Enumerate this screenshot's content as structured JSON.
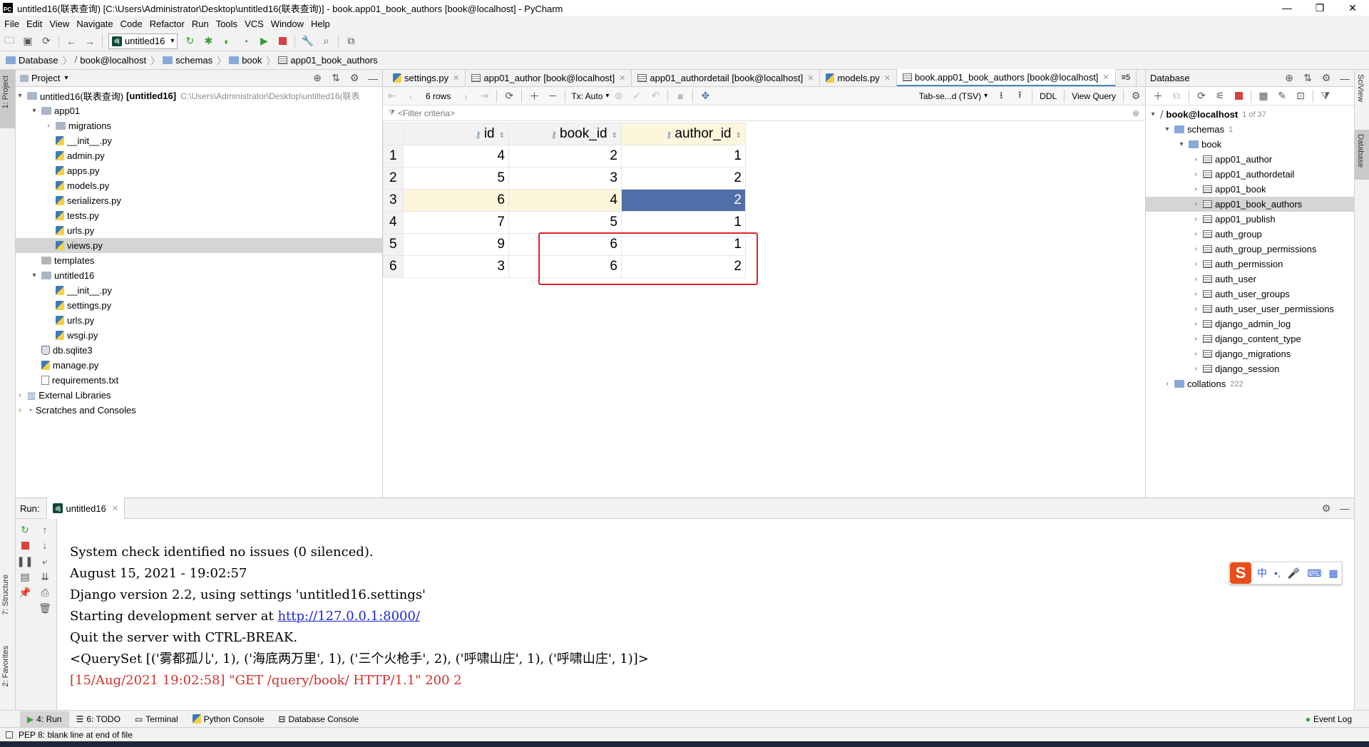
{
  "window": {
    "title": "untitled16(联表查询) [C:\\Users\\Administrator\\Desktop\\untitled16(联表查询)] - book.app01_book_authors [book@localhost] - PyCharm",
    "controls": [
      "—",
      "❐",
      "✕"
    ]
  },
  "menu": [
    "File",
    "Edit",
    "View",
    "Navigate",
    "Code",
    "Refactor",
    "Run",
    "Tools",
    "VCS",
    "Window",
    "Help"
  ],
  "toolbar": {
    "run_config": "untitled16"
  },
  "breadcrumb": [
    "Database",
    "book@localhost",
    "schemas",
    "book",
    "app01_book_authors"
  ],
  "left_strip": {
    "project_tab": "1: Project",
    "structure_tab": "7: Structure",
    "favorites_tab": "2: Favorites"
  },
  "project": {
    "header": "Project",
    "root_name": "untitled16(联表查询)",
    "root_module": "[untitled16]",
    "root_path": "C:\\Users\\Administrator\\Desktop\\untitled16(联表",
    "items": [
      {
        "label": "app01",
        "depth": 1,
        "type": "folder",
        "open": true
      },
      {
        "label": "migrations",
        "depth": 2,
        "type": "folder",
        "open": false
      },
      {
        "label": "__init__.py",
        "depth": 2,
        "type": "py"
      },
      {
        "label": "admin.py",
        "depth": 2,
        "type": "py"
      },
      {
        "label": "apps.py",
        "depth": 2,
        "type": "py"
      },
      {
        "label": "models.py",
        "depth": 2,
        "type": "py"
      },
      {
        "label": "serializers.py",
        "depth": 2,
        "type": "py"
      },
      {
        "label": "tests.py",
        "depth": 2,
        "type": "py"
      },
      {
        "label": "urls.py",
        "depth": 2,
        "type": "py"
      },
      {
        "label": "views.py",
        "depth": 2,
        "type": "py",
        "selected": true
      },
      {
        "label": "templates",
        "depth": 1,
        "type": "folder-plain"
      },
      {
        "label": "untitled16",
        "depth": 1,
        "type": "folder",
        "open": true
      },
      {
        "label": "__init__.py",
        "depth": 2,
        "type": "py"
      },
      {
        "label": "settings.py",
        "depth": 2,
        "type": "py"
      },
      {
        "label": "urls.py",
        "depth": 2,
        "type": "py"
      },
      {
        "label": "wsgi.py",
        "depth": 2,
        "type": "py"
      },
      {
        "label": "db.sqlite3",
        "depth": 1,
        "type": "db"
      },
      {
        "label": "manage.py",
        "depth": 1,
        "type": "py"
      },
      {
        "label": "requirements.txt",
        "depth": 1,
        "type": "txt"
      },
      {
        "label": "External Libraries",
        "depth": 0,
        "type": "lib",
        "open": false
      },
      {
        "label": "Scratches and Consoles",
        "depth": 0,
        "type": "scratch",
        "open": false
      }
    ]
  },
  "editor": {
    "tabs": [
      {
        "label": "settings.py",
        "type": "py"
      },
      {
        "label": "app01_author [book@localhost]",
        "type": "table"
      },
      {
        "label": "app01_authordetail [book@localhost]",
        "type": "table"
      },
      {
        "label": "models.py",
        "type": "py"
      },
      {
        "label": "book.app01_book_authors [book@localhost]",
        "type": "table",
        "active": true
      }
    ],
    "tab_overflow": "≡5",
    "rows_label": "6 rows",
    "tx_label": "Tx: Auto",
    "format_label": "Tab-se...d (TSV)",
    "ddl_label": "DDL",
    "view_query_label": "View Query",
    "filter_placeholder": "<Filter criteria>"
  },
  "table": {
    "columns": [
      "id",
      "book_id",
      "author_id"
    ],
    "rows": [
      {
        "n": "1",
        "id": "4",
        "book_id": "2",
        "author_id": "1"
      },
      {
        "n": "2",
        "id": "5",
        "book_id": "3",
        "author_id": "2"
      },
      {
        "n": "3",
        "id": "6",
        "book_id": "4",
        "author_id": "2"
      },
      {
        "n": "4",
        "id": "7",
        "book_id": "5",
        "author_id": "1"
      },
      {
        "n": "5",
        "id": "9",
        "book_id": "6",
        "author_id": "1"
      },
      {
        "n": "6",
        "id": "3",
        "book_id": "6",
        "author_id": "2"
      }
    ],
    "highlighted_row": 3,
    "selected_cell": "author_id",
    "boxed_rows": [
      5,
      6
    ]
  },
  "database": {
    "header": "Database",
    "connection": "book@localhost",
    "connection_meta": "1 of 37",
    "schemas_label": "schemas",
    "schemas_count": "1",
    "schema": "book",
    "tables": [
      "app01_author",
      "app01_authordetail",
      "app01_book",
      "app01_book_authors",
      "app01_publish",
      "auth_group",
      "auth_group_permissions",
      "auth_permission",
      "auth_user",
      "auth_user_groups",
      "auth_user_user_permissions",
      "django_admin_log",
      "django_content_type",
      "django_migrations",
      "django_session"
    ],
    "selected_table": "app01_book_authors",
    "collations_label": "collations",
    "collations_count": "222"
  },
  "right_strip": {
    "sciview": "SciView",
    "database": "Database"
  },
  "run": {
    "label": "Run:",
    "tab": "untitled16",
    "console": [
      {
        "text": "System check identified no issues (0 silenced).",
        "type": "normal"
      },
      {
        "text": "August 15, 2021 - 19:02:57",
        "type": "normal"
      },
      {
        "text": "Django version 2.2, using settings 'untitled16.settings'",
        "type": "normal"
      },
      {
        "text": "Starting development server at ",
        "link": "http://127.0.0.1:8000/",
        "type": "link"
      },
      {
        "text": "Quit the server with CTRL-BREAK.",
        "type": "normal"
      },
      {
        "text": "<QuerySet [('雾都孤儿', 1), ('海底两万里', 1), ('三个火枪手', 2), ('呼啸山庄', 1), ('呼啸山庄', 1)]>",
        "type": "normal"
      },
      {
        "text": "[15/Aug/2021 19:02:58] \"GET /query/book/ HTTP/1.1\" 200 2",
        "type": "error"
      }
    ]
  },
  "bottom_tabs": [
    "4: Run",
    "6: TODO",
    "Terminal",
    "Python Console",
    "Database Console"
  ],
  "event_log": "Event Log",
  "status": "PEP 8: blank line at end of file",
  "ime": {
    "logo": "S",
    "items": [
      "中",
      "•,",
      "🎤",
      "⌨",
      "▦"
    ]
  }
}
